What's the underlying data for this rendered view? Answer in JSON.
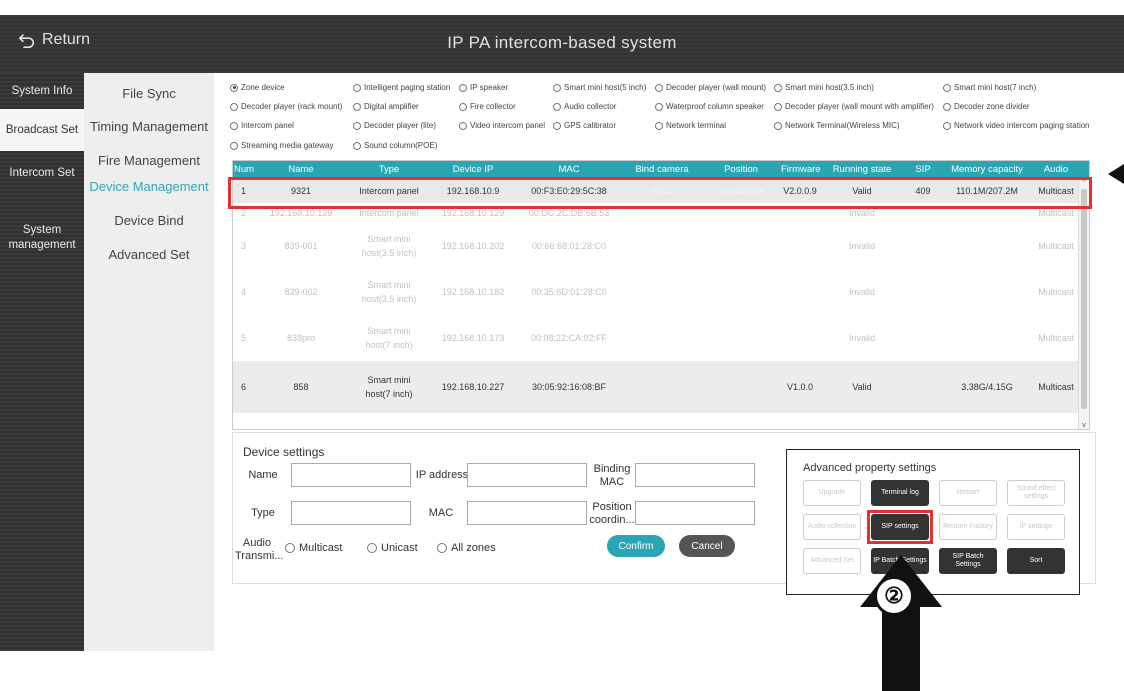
{
  "header": {
    "return_label": "Return",
    "title": "IP PA intercom-based system"
  },
  "nav_primary": [
    {
      "label": "System Info"
    },
    {
      "label": "Broadcast Set"
    },
    {
      "label": "Intercom Set"
    },
    {
      "label": "System management"
    }
  ],
  "nav_secondary": [
    {
      "label": "File Sync"
    },
    {
      "label": "Timing Management"
    },
    {
      "label": "Fire Management"
    },
    {
      "label": "Device Management"
    },
    {
      "label": "Device Bind"
    },
    {
      "label": "Advanced Set"
    }
  ],
  "device_types": [
    "Zone device",
    "Intelligent paging station",
    "IP speaker",
    "Smart mini host(5 inch)",
    "Decoder player (wall mount)",
    "Smart mini host(3.5 inch)",
    "Smart mini host(7 inch)",
    "Decoder player (rack mount)",
    "Digital amplifier",
    "Fire collector",
    "Audio collector",
    "Waterproof column speaker",
    "Decoder player (wall mount with amplifier)",
    "Decoder zone divider",
    "Intercom panel",
    "Decoder player (lite)",
    "Video intercom panel",
    "GPS calibrator",
    "Network terminal",
    "Network Terminal(Wireless MIC)",
    "Network video intercom paging station",
    "Streaming media gateway",
    "Sound column(POE)"
  ],
  "selected_device_type": "Zone device",
  "table": {
    "columns": [
      "Num",
      "Name",
      "Type",
      "Device IP",
      "MAC",
      "Bind camera",
      "Position",
      "Firmware",
      "Running state",
      "SIP",
      "Memory capacity",
      "Audio"
    ],
    "rows": [
      {
        "num": "1",
        "name": "9321",
        "type": "Intercom panel",
        "ip": "192.168.10.9",
        "mac": "00:F3:E0:29:5C:38",
        "camera": "MAC",
        "position": "coordinates",
        "firmware": "V2.0.0.9",
        "state": "Valid",
        "sip": "409",
        "memory": "110.1M/207.2M",
        "audio": "Multicast"
      },
      {
        "num": "2",
        "name": "192.168.10.129",
        "type": "Intercom panel",
        "ip": "192.168.10.129",
        "mac": "00:DC:2C:DB:6B:53",
        "camera": "",
        "position": "",
        "firmware": "",
        "state": "Invalid",
        "sip": "",
        "memory": "",
        "audio": "Multicast"
      },
      {
        "num": "3",
        "name": "839-001",
        "type": "Smart mini host(3.5 inch)",
        "ip": "192.168.10.202",
        "mac": "00:66:68:01:28:C0",
        "camera": "",
        "position": "",
        "firmware": "",
        "state": "Invalid",
        "sip": "",
        "memory": "",
        "audio": "Multicast"
      },
      {
        "num": "4",
        "name": "839-002",
        "type": "Smart mini host(3.5 inch)",
        "ip": "192.168.10.182",
        "mac": "00:35:6D:01:28:C0",
        "camera": "",
        "position": "",
        "firmware": "",
        "state": "Invalid",
        "sip": "",
        "memory": "",
        "audio": "Multicast"
      },
      {
        "num": "5",
        "name": "838pro",
        "type": "Smart mini host(7 inch)",
        "ip": "192.168.10.173",
        "mac": "00:08:22:CA:02:FF",
        "camera": "",
        "position": "",
        "firmware": "",
        "state": "Invalid",
        "sip": "",
        "memory": "",
        "audio": "Multicast"
      },
      {
        "num": "6",
        "name": "858",
        "type": "Smart mini host(7 inch)",
        "ip": "192.168.10.227",
        "mac": "30:05:92:16:08:BF",
        "camera": "",
        "position": "",
        "firmware": "V1.0.0",
        "state": "Valid",
        "sip": "",
        "memory": "3.38G/4.15G",
        "audio": "Multicast"
      }
    ]
  },
  "device_settings": {
    "title": "Device settings",
    "name_label": "Name",
    "ip_label": "IP address",
    "binding_mac_label": "Binding MAC",
    "type_label": "Type",
    "mac_label": "MAC",
    "position_label": "Position coordin...",
    "audio_label": "Audio Transmi...",
    "audio_options": [
      "Multicast",
      "Unicast",
      "All zones"
    ],
    "confirm_label": "Confirm",
    "cancel_label": "Cancel"
  },
  "advanced": {
    "title": "Advanced property settings",
    "buttons": [
      {
        "label": "Upgrade"
      },
      {
        "label": "Terminal log"
      },
      {
        "label": "Restart"
      },
      {
        "label": "Sound effect settings"
      },
      {
        "label": "Audio collection"
      },
      {
        "label": "SIP settings"
      },
      {
        "label": "Restore Factory"
      },
      {
        "label": "IP settings"
      },
      {
        "label": "Advanced Set"
      },
      {
        "label": "IP Batch Settings"
      },
      {
        "label": "SIP Batch Settings"
      },
      {
        "label": "Sort"
      }
    ]
  },
  "annotation": {
    "step_marker": "②"
  },
  "colors": {
    "accent": "#2aa5b4",
    "highlight": "#e23131",
    "header_bg": "#333333"
  }
}
